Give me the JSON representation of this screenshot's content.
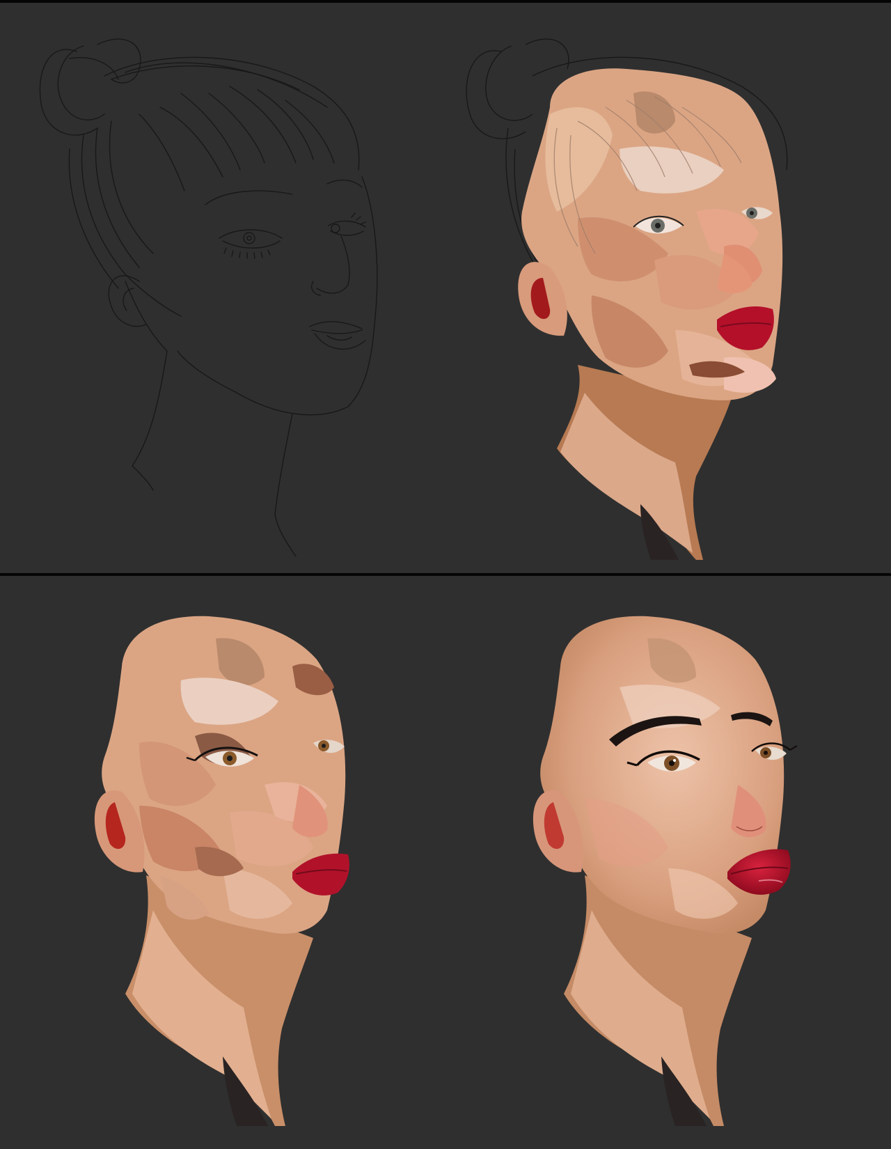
{
  "colors": {
    "background": "#2f2f2f",
    "divider": "#050505",
    "sketch_line": "#151515",
    "skin_base": "#d9a27f",
    "skin_light": "#e8b69a",
    "skin_shadow": "#b77556",
    "lip_red": "#b30f27",
    "brow_dark": "#1c1412"
  },
  "panels": [
    {
      "stage": "sketch"
    },
    {
      "stage": "sketch-with-block-in"
    },
    {
      "stage": "color-block-in"
    },
    {
      "stage": "refined-render"
    }
  ]
}
